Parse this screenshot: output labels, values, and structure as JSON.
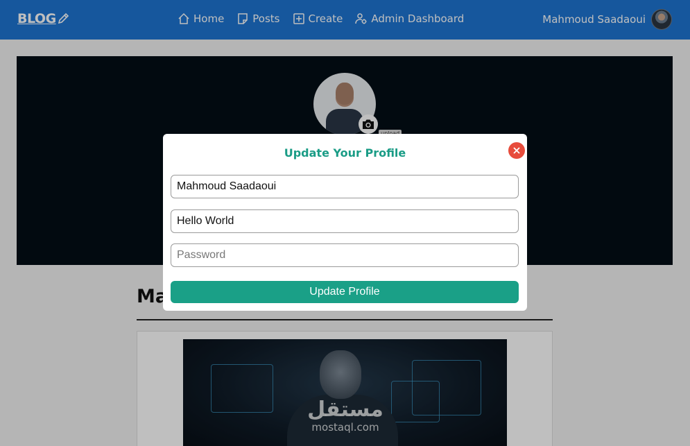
{
  "navbar": {
    "logo_text": "BLOG",
    "links": [
      {
        "label": "Home",
        "icon": "home-icon"
      },
      {
        "label": "Posts",
        "icon": "posts-icon"
      },
      {
        "label": "Create",
        "icon": "create-icon"
      },
      {
        "label": "Admin Dashboard",
        "icon": "admin-icon"
      }
    ],
    "user_name": "Mahmoud Saadaoui"
  },
  "profile": {
    "upload_label": "upload",
    "heading": "Ma"
  },
  "post": {
    "watermark_arabic": "مستقل",
    "watermark_latin": "mostaql.com"
  },
  "modal": {
    "title": "Update Your Profile",
    "username_value": "Mahmoud Saadaoui",
    "bio_value": "Hello World",
    "password_placeholder": "Password",
    "submit_label": "Update Profile"
  },
  "colors": {
    "navbar": "#1e74d2",
    "accent": "#1aa087",
    "close": "#e74c3c",
    "header_bg": "#030e16"
  }
}
